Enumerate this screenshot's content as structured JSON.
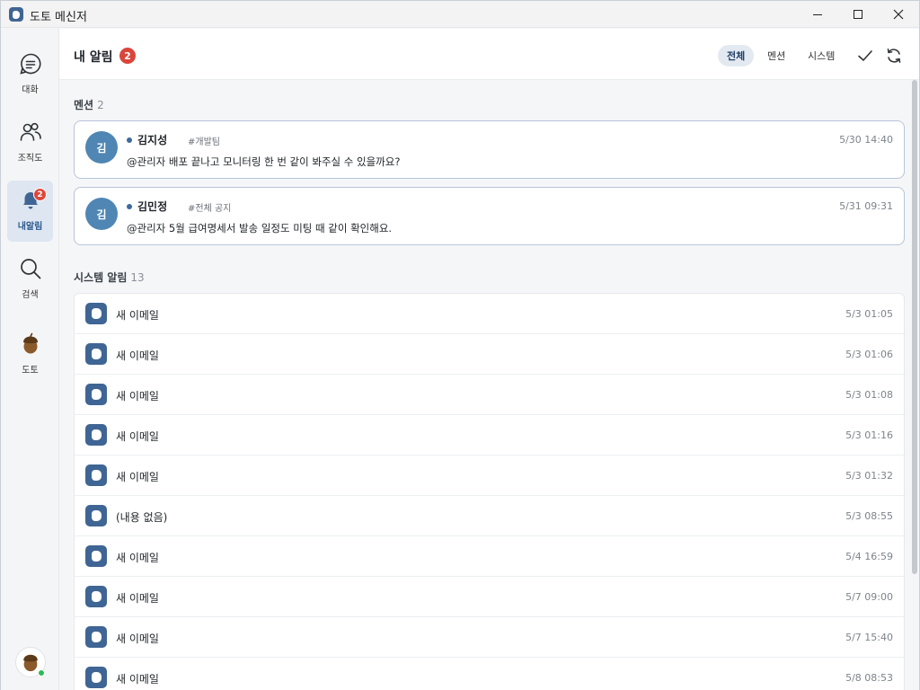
{
  "window": {
    "title": "도토 메신저"
  },
  "sidebar": {
    "items": [
      {
        "label": "대화",
        "icon": "chat-icon"
      },
      {
        "label": "조직도",
        "icon": "people-icon"
      },
      {
        "label": "내알림",
        "icon": "bell-icon",
        "badge": "2",
        "active": true
      },
      {
        "label": "검색",
        "icon": "search-icon"
      },
      {
        "label": "도토",
        "icon": "acorn-icon"
      }
    ],
    "profile_status": "online"
  },
  "header": {
    "title": "내 알림",
    "badge": "2",
    "filters": [
      {
        "label": "전체",
        "active": true
      },
      {
        "label": "멘션",
        "active": false
      },
      {
        "label": "시스템",
        "active": false
      }
    ]
  },
  "mentions": {
    "label": "멘션",
    "count": "2",
    "items": [
      {
        "avatar": "김",
        "sender": "김지성",
        "channel": "#개발팀",
        "time": "5/30 14:40",
        "text": "@관리자 배포 끝나고 모니터링 한 번 같이 봐주실 수 있을까요?"
      },
      {
        "avatar": "김",
        "sender": "김민정",
        "channel": "#전체 공지",
        "time": "5/31 09:31",
        "text": "@관리자 5월 급여명세서 발송 일정도 미팅 때 같이 확인해요."
      }
    ]
  },
  "system": {
    "label": "시스템 알림",
    "count": "13",
    "items": [
      {
        "text": "새 이메일",
        "time": "5/3 01:05"
      },
      {
        "text": "새 이메일",
        "time": "5/3 01:06"
      },
      {
        "text": "새 이메일",
        "time": "5/3 01:08"
      },
      {
        "text": "새 이메일",
        "time": "5/3 01:16"
      },
      {
        "text": "새 이메일",
        "time": "5/3 01:32"
      },
      {
        "text": "(내용 없음)",
        "time": "5/3 08:55"
      },
      {
        "text": "새 이메일",
        "time": "5/4 16:59"
      },
      {
        "text": "새 이메일",
        "time": "5/7 09:00"
      },
      {
        "text": "새 이메일",
        "time": "5/7 15:40"
      },
      {
        "text": "새 이메일",
        "time": "5/8 08:53"
      }
    ]
  },
  "colors": {
    "accent": "#3f6594",
    "badge": "#d9463b",
    "avatar": "#4f86b3",
    "online": "#2dba57"
  }
}
